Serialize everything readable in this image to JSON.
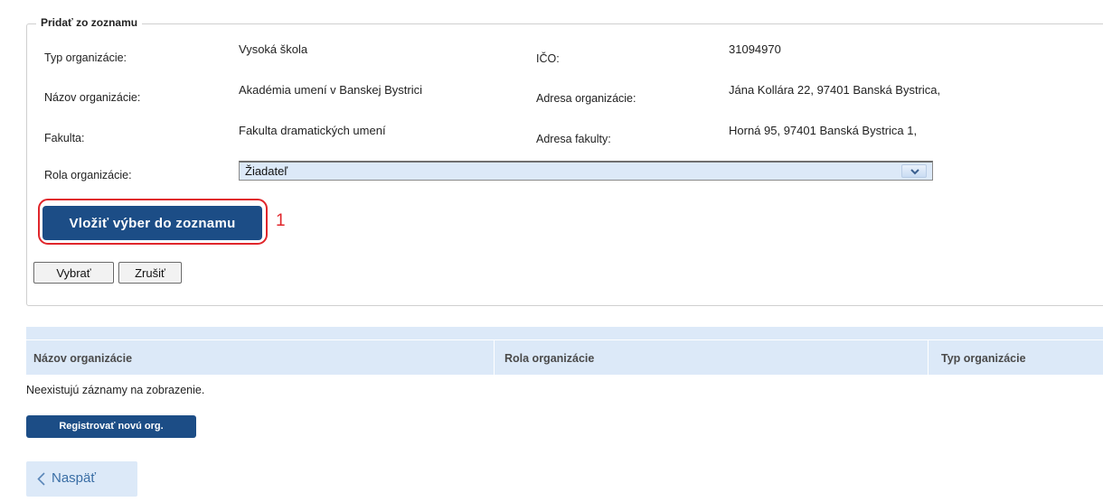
{
  "section": {
    "legend": "Pridať zo zoznamu"
  },
  "fields": {
    "typ_label": "Typ organizácie:",
    "typ_value": "Vysoká škola",
    "ico_label": "IČO:",
    "ico_value": "31094970",
    "nazov_label": "Názov organizácie:",
    "nazov_value": "Akadémia umení v Banskej Bystrici",
    "adresa_label": "Adresa organizácie:",
    "adresa_value": "Jána Kollára 22, 97401 Banská Bystrica,",
    "fakulta_label": "Fakulta:",
    "fakulta_value": "Fakulta dramatických umení",
    "adresa_fakulty_label": "Adresa fakulty:",
    "adresa_fakulty_value": "Horná 95, 97401 Banská Bystrica 1,",
    "rola_label": "Rola organizácie:",
    "rola_selected": "Žiadateľ"
  },
  "actions": {
    "insert_label": "Vložiť výber do zoznamu",
    "annotation_number": "1",
    "select_label": "Vybrať",
    "cancel_label": "Zrušiť"
  },
  "table": {
    "columns": [
      "Názov organizácie",
      "Rola organizácie",
      "Typ organizácie"
    ],
    "empty_message": "Neexistujú záznamy na zobrazenie."
  },
  "footer": {
    "register_label": "Registrovať novú org.",
    "back_label": "Naspäť"
  },
  "colors": {
    "primary": "#1c4d86",
    "highlight": "#e0262b",
    "light_blue": "#dce9f8"
  },
  "icons": {
    "dropdown": "chevron-down-icon",
    "back": "chevron-left-icon"
  }
}
